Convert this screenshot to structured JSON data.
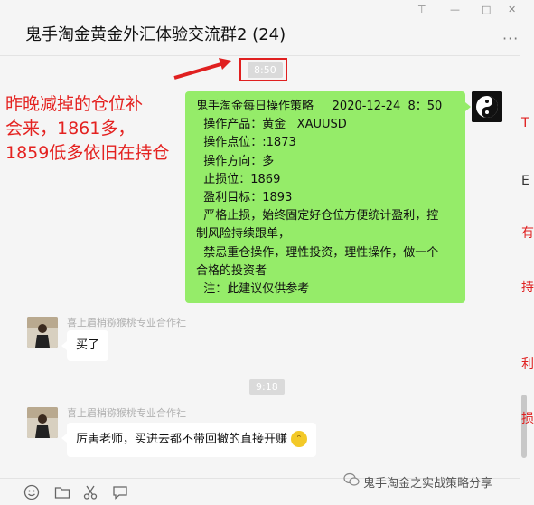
{
  "window": {
    "title": "鬼手淘金黄金外汇体验交流群2 (24)",
    "controls": {
      "pin": "⊤",
      "minimize": "—",
      "maximize": "□",
      "close": "✕"
    },
    "more_icon": "···"
  },
  "times": {
    "first": "8:50",
    "second": "9:18"
  },
  "annotation": {
    "lines": [
      "昨晚减掉的仓位补",
      "会来，1861多，",
      "1859低多依旧在持仓"
    ],
    "color": "#e42220"
  },
  "strategy_message": {
    "lines": [
      "鬼手淘金每日操作策略     2020-12-24  8：50",
      "  操作产品：黄金   XAUUSD",
      "  操作点位：:1873",
      "  操作方向：多",
      "  止损位：1869",
      "  盈利目标：1893",
      "  严格止损，始终固定好仓位方便统计盈利，控",
      "制风险持续跟单，",
      "  禁忌重仓操作，理性投资，理性操作，做一个",
      "合格的投资者",
      "  注：此建议仅供参考"
    ],
    "bubble_color": "#95ec69"
  },
  "messages": [
    {
      "sender": "喜上眉梢猕猴桃专业合作社",
      "text": "买了"
    },
    {
      "sender": "喜上眉梢猕猴桃专业合作社",
      "text": "厉害老师，买进去都不带回撤的直接开赚"
    }
  ],
  "toolbar": {
    "icons": [
      "emoji-icon",
      "folder-icon",
      "scissors-icon",
      "chat-icon"
    ]
  },
  "watermark": "鬼手淘金之实战策略分享"
}
